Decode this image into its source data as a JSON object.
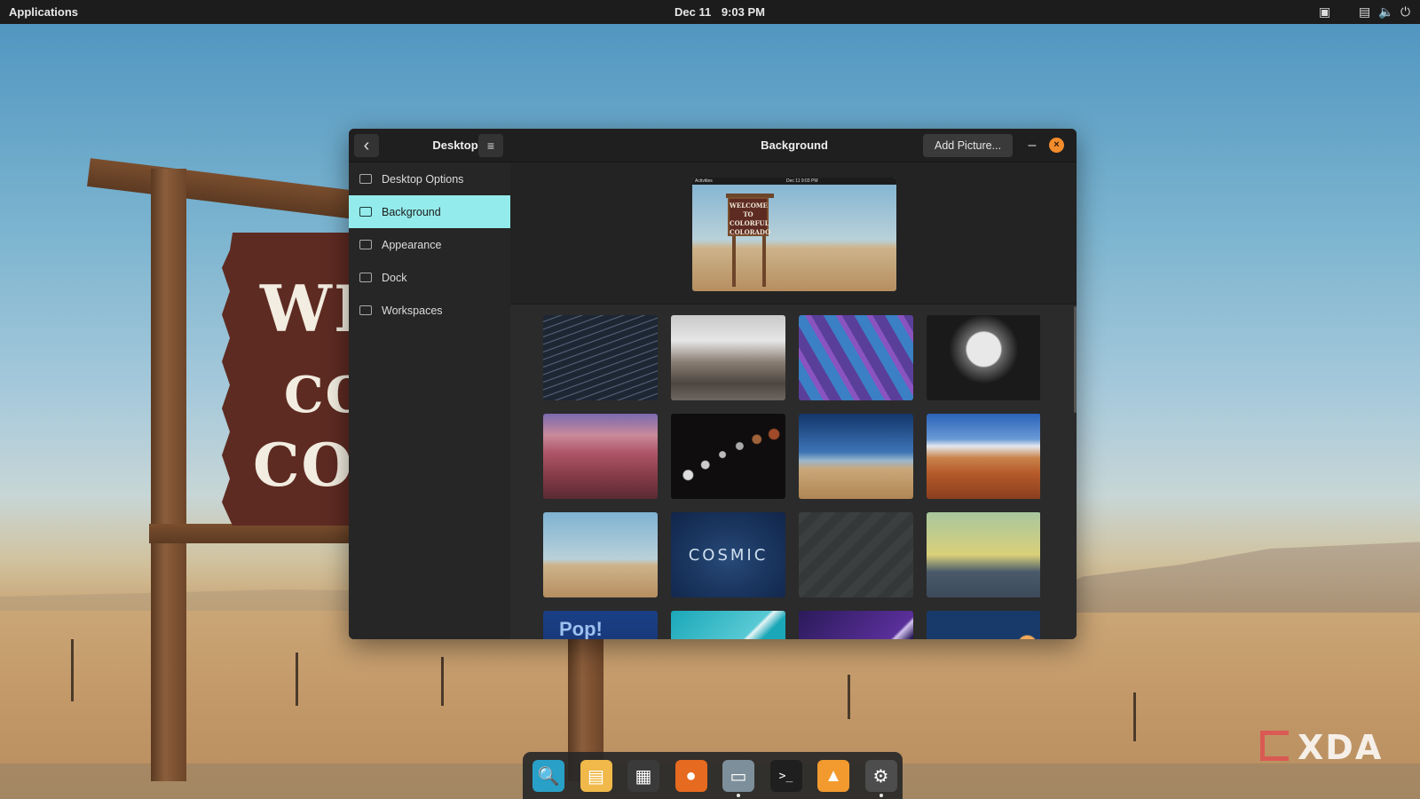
{
  "top_panel": {
    "applications_label": "Applications",
    "date": "Dec 11",
    "time": "9:03 PM"
  },
  "window": {
    "sidebar_title": "Desktop",
    "page_title": "Background",
    "add_picture_label": "Add Picture...",
    "minimize_label": "–",
    "close_label": "×",
    "menu_label": "≡",
    "back_label": "‹"
  },
  "sidebar": {
    "items": [
      {
        "label": "Desktop Options",
        "icon": "monitor-icon",
        "active": false
      },
      {
        "label": "Background",
        "icon": "wallpaper-icon",
        "active": true
      },
      {
        "label": "Appearance",
        "icon": "appearance-icon",
        "active": false
      },
      {
        "label": "Dock",
        "icon": "dock-icon",
        "active": false
      },
      {
        "label": "Workspaces",
        "icon": "workspaces-icon",
        "active": false
      }
    ]
  },
  "preview": {
    "bar_left": "Activities",
    "bar_clock": "Dec 11 9:03 PM",
    "sign_text": "WELCOME TO COLORFUL COLORADO"
  },
  "wallpapers": [
    {
      "name": "star-trails",
      "style": "t-stars"
    },
    {
      "name": "snowy-mountains",
      "style": "t-mountain"
    },
    {
      "name": "geodesic-dome",
      "style": "t-dome"
    },
    {
      "name": "radio-dish",
      "style": "t-dish"
    },
    {
      "name": "canyon",
      "style": "t-canyon"
    },
    {
      "name": "lunar-eclipse",
      "style": "t-moons"
    },
    {
      "name": "sand-dunes",
      "style": "t-dunes"
    },
    {
      "name": "monument-valley",
      "style": "t-valley"
    },
    {
      "name": "colorado-sign",
      "style": "t-colorado",
      "selected": true
    },
    {
      "name": "cosmic",
      "style": "t-cosmic",
      "text": "COSMIC"
    },
    {
      "name": "chevrons",
      "style": "t-chevrons"
    },
    {
      "name": "robot-city",
      "style": "t-robot"
    },
    {
      "name": "pop",
      "style": "t-pop",
      "text": "Pop!"
    },
    {
      "name": "teal-abstract",
      "style": "t-teal"
    },
    {
      "name": "purple-abstract",
      "style": "t-purple"
    },
    {
      "name": "planets",
      "style": "t-planet"
    }
  ],
  "desktop": {
    "sign_line1": "WEL",
    "sign_line2": "CO",
    "sign_line3": "COL",
    "watermark": "XDA"
  },
  "dock": {
    "items": [
      {
        "name": "search-app",
        "glyph": "🔍",
        "bg": "#29a0c8",
        "running": false
      },
      {
        "name": "workspaces-app",
        "glyph": "▤",
        "bg": "#f0b94a",
        "running": false
      },
      {
        "name": "app-grid",
        "glyph": "▦",
        "bg": "#3a3a3a",
        "running": false
      },
      {
        "name": "firefox",
        "glyph": "●",
        "bg": "#e66a1f",
        "running": false
      },
      {
        "name": "files",
        "glyph": "▭",
        "bg": "#7d8f9a",
        "running": true
      },
      {
        "name": "terminal",
        "glyph": ">_",
        "bg": "#1f1f1f",
        "running": false
      },
      {
        "name": "pop-shop",
        "glyph": "▲",
        "bg": "#f29a2e",
        "running": false
      },
      {
        "name": "settings",
        "glyph": "⚙",
        "bg": "#4d4d4d",
        "running": true
      }
    ]
  }
}
